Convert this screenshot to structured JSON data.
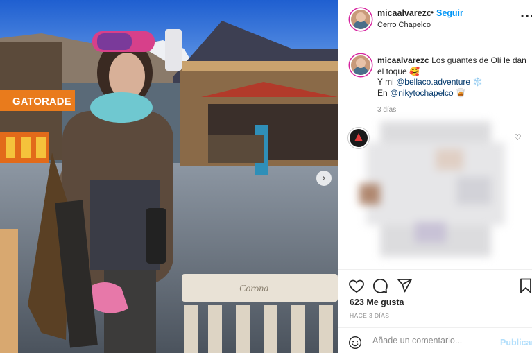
{
  "post": {
    "username": "micaalvarezc",
    "dot": "•",
    "follow_label": "Seguir",
    "location": "Cerro Chapelco",
    "more_icon": "more-icon",
    "next_icon": "chevron-right-icon",
    "next_glyph": "›"
  },
  "photo": {
    "sign_text": "GATORADE",
    "bench_text": "Corona"
  },
  "caption": {
    "username": "micaalvarezc",
    "line1": "Los guantes de Olí le dan el toque 🥰",
    "line2_prefix": "Y mi ",
    "line2_mention": "@bellaco.adventure",
    "line2_suffix": " ❄️",
    "line3_prefix": "En ",
    "line3_mention": "@nikytochapelco",
    "line3_suffix": " 🥃",
    "time": "3 días"
  },
  "actions": {
    "likes": "623 Me gusta",
    "posted_ago": "HACE 3 DÍAS"
  },
  "comment_box": {
    "placeholder": "Añade un comentario...",
    "publish_label": "Publicar"
  },
  "colors": {
    "follow": "#0095f6",
    "mention": "#00376b",
    "publish_disabled": "#b2dffc",
    "muted": "#8e8e8e"
  }
}
